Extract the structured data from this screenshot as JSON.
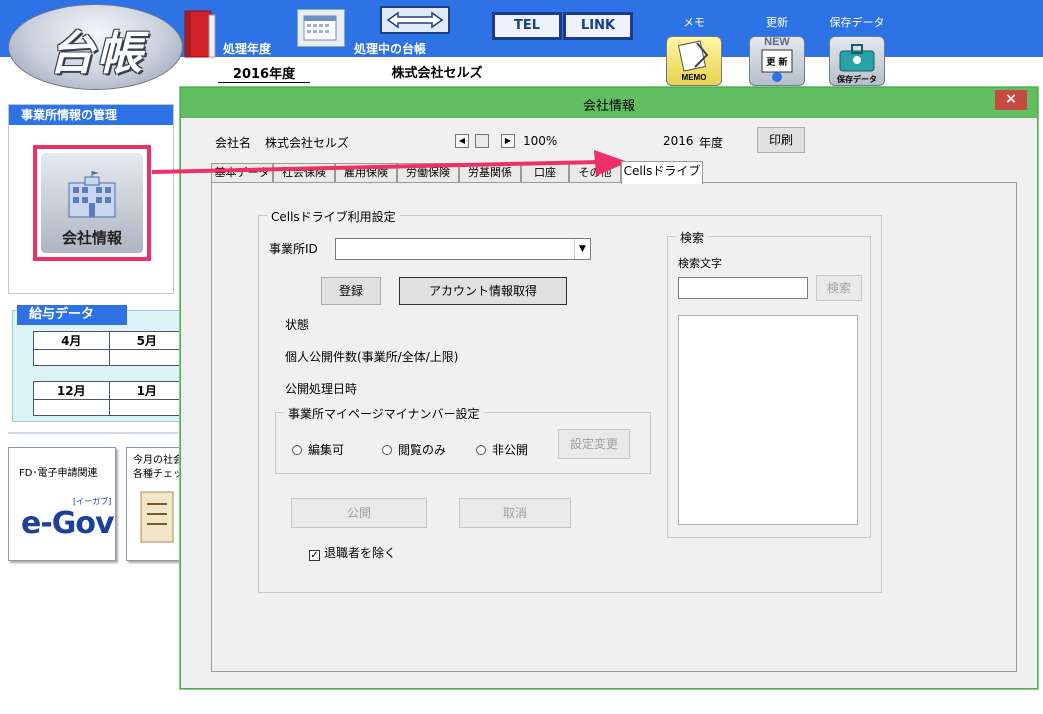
{
  "header": {
    "logo_text": "台帳",
    "year_label": "処理年度",
    "year_value": "2016年度",
    "current_ledger_label": "処理中の台帳",
    "company_value": "株式会社セルズ",
    "tel_button": "TEL",
    "link_button": "LINK",
    "memo_label": "メモ",
    "memo_icon_text": "MEMO",
    "update_label": "更新",
    "update_icon_new": "NEW",
    "update_icon_text": "更 新",
    "save_label": "保存データ",
    "save_icon_text": "保存データ"
  },
  "left": {
    "panel1_title": "事業所情報の管理",
    "company_button": "会社情報",
    "panel2_title": "給与データ",
    "months_row1": [
      "4月",
      "5月"
    ],
    "months_row2": [
      "12月",
      "1月"
    ],
    "fd_text": "FD･電子申請関連",
    "egov_text": "e-Gov",
    "egov_sub": "[イーガブ]",
    "check_text_line1": "今月の社会",
    "check_text_line2": "各種チェッ"
  },
  "dialog": {
    "title": "会社情報",
    "close": "×",
    "company_label": "会社名",
    "company_name": "株式会社セルズ",
    "zoom": "100%",
    "year": "2016",
    "year_unit": "年度",
    "print_button": "印刷",
    "tabs": [
      {
        "label": "基本データ"
      },
      {
        "label": "社会保険"
      },
      {
        "label": "雇用保険"
      },
      {
        "label": "労働保険"
      },
      {
        "label": "労基関係"
      },
      {
        "label": "口座"
      },
      {
        "label": "その他"
      },
      {
        "label": "Cellsドライブ"
      }
    ],
    "active_tab": "Cellsドライブ",
    "cells_group_title": "Cellsドライブ利用設定",
    "office_id_label": "事業所ID",
    "office_id_value": "",
    "register_button": "登録",
    "account_button": "アカウント情報取得",
    "status_label": "状態",
    "public_count_label": "個人公開件数(事業所/全体/上限)",
    "public_datetime_label": "公開処理日時",
    "mynumber_group_title": "事業所マイページマイナンバー設定",
    "radio_editable": "編集可",
    "radio_readonly": "閲覧のみ",
    "radio_private": "非公開",
    "settings_change_button": "設定変更",
    "publish_button": "公開",
    "cancel_button": "取消",
    "exclude_retired_label": "退職者を除く",
    "exclude_retired_checked": "✓",
    "search_group_title": "検索",
    "search_text_label": "検索文字",
    "search_input_value": "",
    "search_button": "検索"
  },
  "colors": {
    "header_blue": "#2d73e6",
    "dialog_title_green": "#61bf62",
    "highlight_pink": "#ee2f68",
    "close_red": "#c7493f"
  }
}
